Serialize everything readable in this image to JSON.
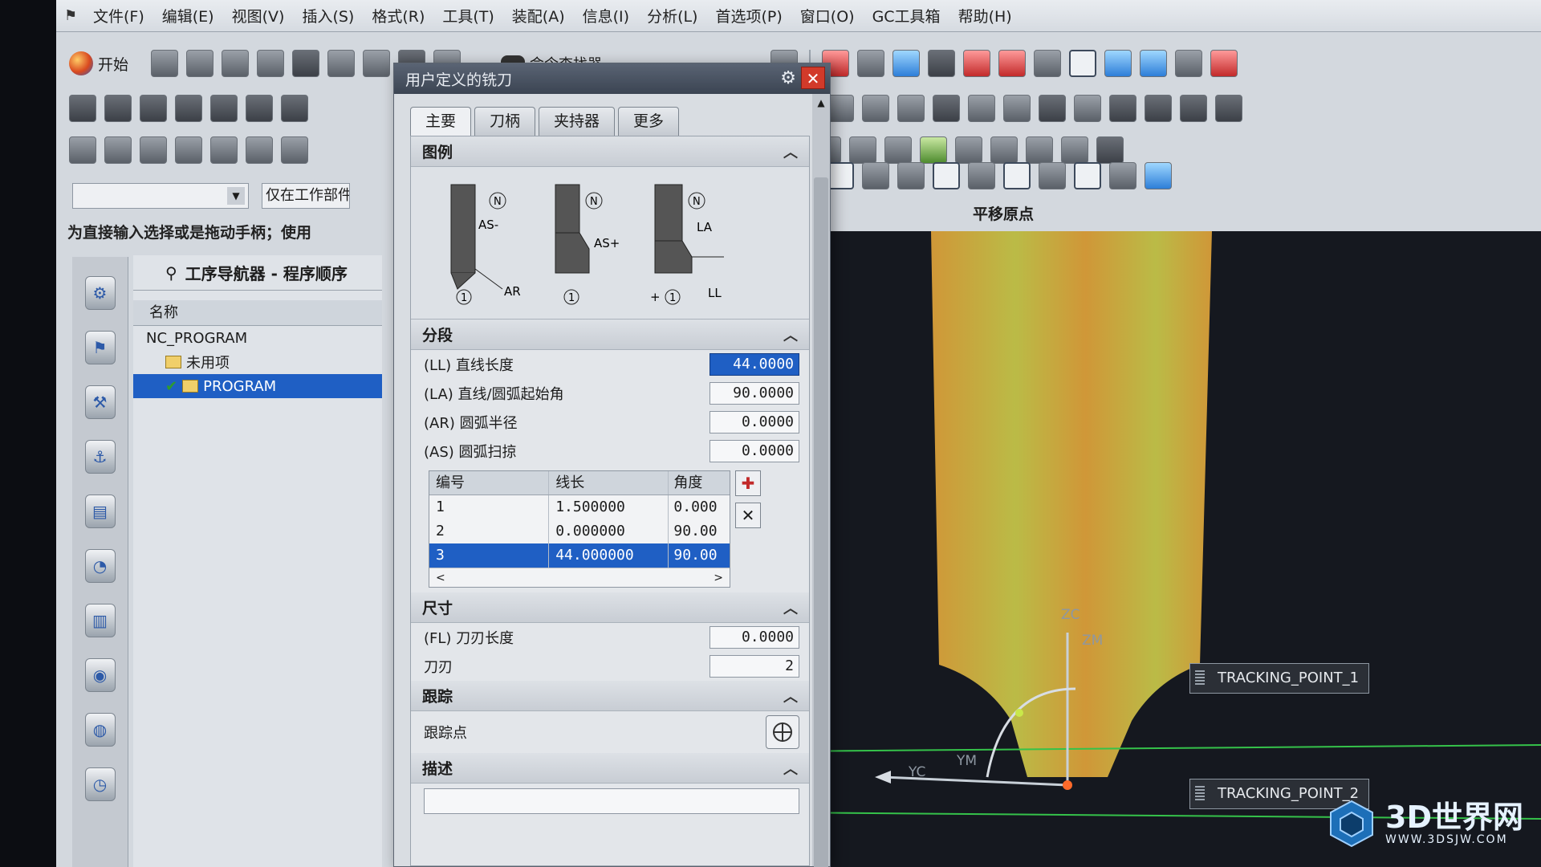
{
  "menubar": {
    "items": [
      "文件(F)",
      "编辑(E)",
      "视图(V)",
      "插入(S)",
      "格式(R)",
      "工具(T)",
      "装配(A)",
      "信息(I)",
      "分析(L)",
      "首选项(P)",
      "窗口(O)",
      "GC工具箱",
      "帮助(H)"
    ]
  },
  "toolbar": {
    "start_label": "开始",
    "command_finder_label": "命令查找器",
    "snap_title": "平移原点"
  },
  "left_panel": {
    "scope_filter": "仅在工作部件内",
    "cue_line": "为直接输入选择或是拖动手柄；使用",
    "navigator_title": "工序导航器 - 程序顺序",
    "column_header": "名称",
    "tree": [
      {
        "label": "NC_PROGRAM"
      },
      {
        "label": "未用项"
      },
      {
        "label": "PROGRAM"
      }
    ]
  },
  "dialog": {
    "title": "用户定义的铣刀",
    "tabs": [
      "主要",
      "刀柄",
      "夹持器",
      "更多"
    ],
    "legend_section": "图例",
    "segments_section": "分段",
    "illustration_labels": {
      "n": "N",
      "one": "1",
      "as_minus": "AS-",
      "as_plus": "AS+",
      "ar": "AR",
      "la": "LA",
      "ll": "LL",
      "plus": "+"
    },
    "fields": {
      "ll_label": "(LL) 直线长度",
      "ll_value": "44.0000",
      "la_label": "(LA) 直线/圆弧起始角",
      "la_value": "90.0000",
      "ar_label": "(AR) 圆弧半径",
      "ar_value": "0.0000",
      "as_label": "(AS) 圆弧扫掠",
      "as_value": "0.0000"
    },
    "segment_table": {
      "headers": [
        "编号",
        "线长",
        "角度"
      ],
      "rows": [
        {
          "no": "1",
          "length": "1.500000",
          "angle": "0.000"
        },
        {
          "no": "2",
          "length": "0.000000",
          "angle": "90.00"
        },
        {
          "no": "3",
          "length": "44.000000",
          "angle": "90.00"
        }
      ],
      "selected_row": 3
    },
    "dimensions_section": "尺寸",
    "fl_label": "(FL) 刀刃长度",
    "fl_value": "0.0000",
    "flutes_label": "刀刃",
    "flutes_value": "2",
    "tracking_section": "跟踪",
    "tracking_point_label": "跟踪点",
    "description_section": "描述"
  },
  "viewport": {
    "axis_zc": "ZC",
    "axis_zm": "ZM",
    "axis_yc": "YC",
    "axis_ym": "YM",
    "tracking_point_1": "TRACKING_POINT_1",
    "tracking_point_2": "TRACKING_POINT_2",
    "tool_color": "#e0a23a",
    "tool_highlight": "#c9c94a"
  },
  "watermark": {
    "big": "3D世界网",
    "small": "WWW.3DSJW.COM"
  }
}
